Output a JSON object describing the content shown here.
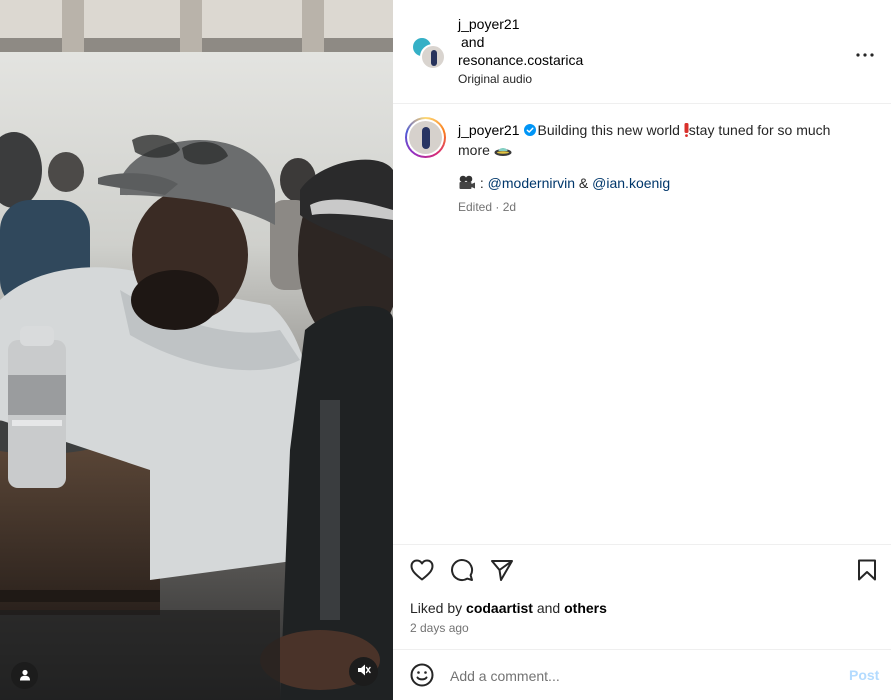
{
  "post": {
    "author_primary": "j_poyer21",
    "author_joiner": "and",
    "author_secondary": "resonance.costarica",
    "audio_label": "Original audio"
  },
  "caption": {
    "username": "j_poyer21",
    "text_part1": "Building this new world ",
    "text_part2": "stay tuned for so much more ",
    "credit_prefix": " : ",
    "credit_mention_1": "@modernirvin",
    "credit_joiner": " & ",
    "credit_mention_2": "@ian.koenig",
    "meta": "Edited · 2d"
  },
  "engagement": {
    "liked_by_prefix": "Liked by ",
    "liked_by_user": "codaartist",
    "liked_by_joiner": " and ",
    "liked_by_others": "others",
    "timestamp": "2 days ago"
  },
  "comment": {
    "placeholder": "Add a comment...",
    "post_label": "Post"
  },
  "icons": {
    "more": "more-options-icon",
    "like": "heart-icon",
    "comment": "comment-icon",
    "share": "send-icon",
    "save": "bookmark-icon",
    "emoji": "smiley-icon",
    "tag": "user-tag-icon",
    "mute": "muted-speaker-icon",
    "verified": "verified-badge-icon"
  },
  "colors": {
    "mention": "#00376b",
    "post_disabled": "#b3dbff",
    "verified": "#0095f6"
  }
}
